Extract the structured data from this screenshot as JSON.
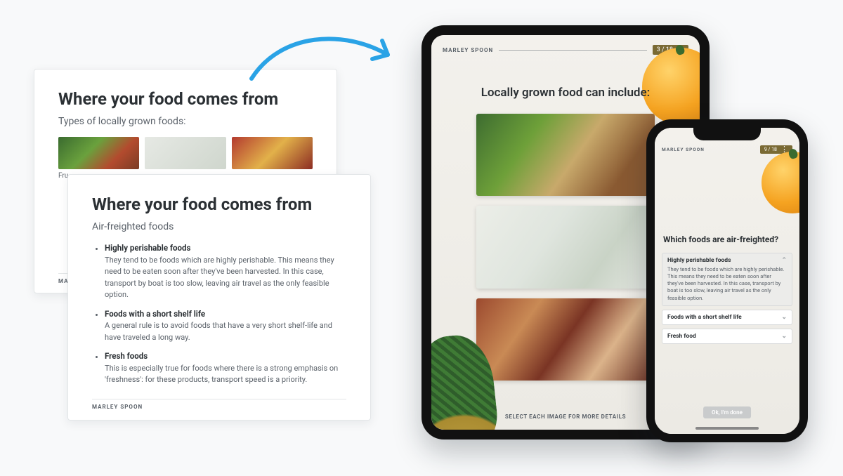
{
  "brand": "MARLEY SPOON",
  "card_back": {
    "title": "Where your food comes from",
    "subtitle": "Types of locally grown foods:",
    "thumbs": [
      "veg",
      "light",
      "red"
    ],
    "thumb_caption": "Fru"
  },
  "card_front": {
    "title": "Where your food comes from",
    "subtitle": "Air-freighted foods",
    "bullets": [
      {
        "head": "Highly perishable foods",
        "body": "They tend to be foods which are highly perishable. This means they need to be eaten soon after they've been harvested. In this case, transport by boat is too slow, leaving air travel as the only feasible option."
      },
      {
        "head": "Foods with a short shelf life",
        "body": "A general rule is to avoid foods that have a very short shelf-life and have traveled a long way."
      },
      {
        "head": "Fresh foods",
        "body": "This is especially true for foods where there is a strong emphasis on 'freshness': for these products, transport speed is a priority."
      }
    ],
    "footer_brand": "MARLEY SPOON"
  },
  "tablet": {
    "brand": "MARLEY SPOON",
    "progress": "3 / 18",
    "heading": "Locally grown food can include:",
    "tiles": [
      "veg",
      "dairy",
      "char"
    ],
    "instruction": "SELECT EACH IMAGE FOR MORE DETAILS"
  },
  "phone": {
    "brand": "MARLEY SPOON",
    "progress": "9 / 18",
    "heading": "Which foods are air-freighted?",
    "items": [
      {
        "head": "Highly perishable foods",
        "open": true,
        "body": "They tend to be foods which are highly perishable. This means they need to be eaten soon after they've been harvested. In this case, transport by boat is too slow, leaving air travel as the only feasible option."
      },
      {
        "head": "Foods with a short shelf life",
        "open": false
      },
      {
        "head": "Fresh food",
        "open": false
      }
    ],
    "done_label": "Ok, I'm done"
  }
}
